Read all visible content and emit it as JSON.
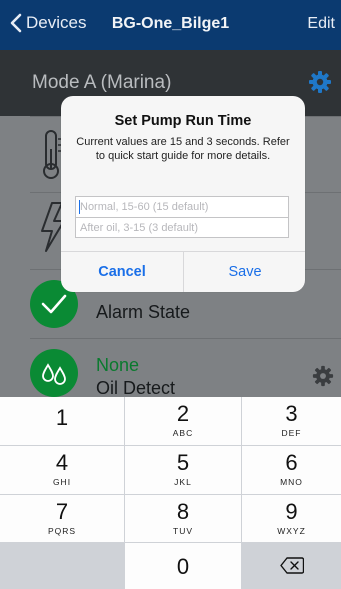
{
  "navbar": {
    "back_label": "Devices",
    "title": "BG-One_Bilge1",
    "edit_label": "Edit",
    "color": "#0b3a70"
  },
  "mode": {
    "label": "Mode A (Marina)",
    "gear_color": "#1f78c8"
  },
  "rows": [
    {
      "icon": "thermometer-icon"
    },
    {
      "icon": "lightning-icon"
    },
    {
      "icon": "checkmark-icon",
      "status": "OK",
      "label": "Alarm State"
    },
    {
      "icon": "oil-drops-icon",
      "status": "None",
      "label": "Oil Detect"
    }
  ],
  "dialog": {
    "title": "Set Pump Run Time",
    "message": "Current values are 15 and 3 seconds. Refer to quick start guide for more details.",
    "input1": {
      "value": "",
      "placeholder": "Normal, 15-60 (15 default)"
    },
    "input2": {
      "value": "",
      "placeholder": "After oil, 3-15 (3 default)"
    },
    "cancel_label": "Cancel",
    "save_label": "Save",
    "accent": "#1a6fe8"
  },
  "keypad": {
    "keys": [
      {
        "digit": "1",
        "letters": ""
      },
      {
        "digit": "2",
        "letters": "ABC"
      },
      {
        "digit": "3",
        "letters": "DEF"
      },
      {
        "digit": "4",
        "letters": "GHI"
      },
      {
        "digit": "5",
        "letters": "JKL"
      },
      {
        "digit": "6",
        "letters": "MNO"
      },
      {
        "digit": "7",
        "letters": "PQRS"
      },
      {
        "digit": "8",
        "letters": "TUV"
      },
      {
        "digit": "9",
        "letters": "WXYZ"
      },
      {
        "digit": "0",
        "letters": ""
      }
    ],
    "backspace_icon": "backspace-icon"
  }
}
